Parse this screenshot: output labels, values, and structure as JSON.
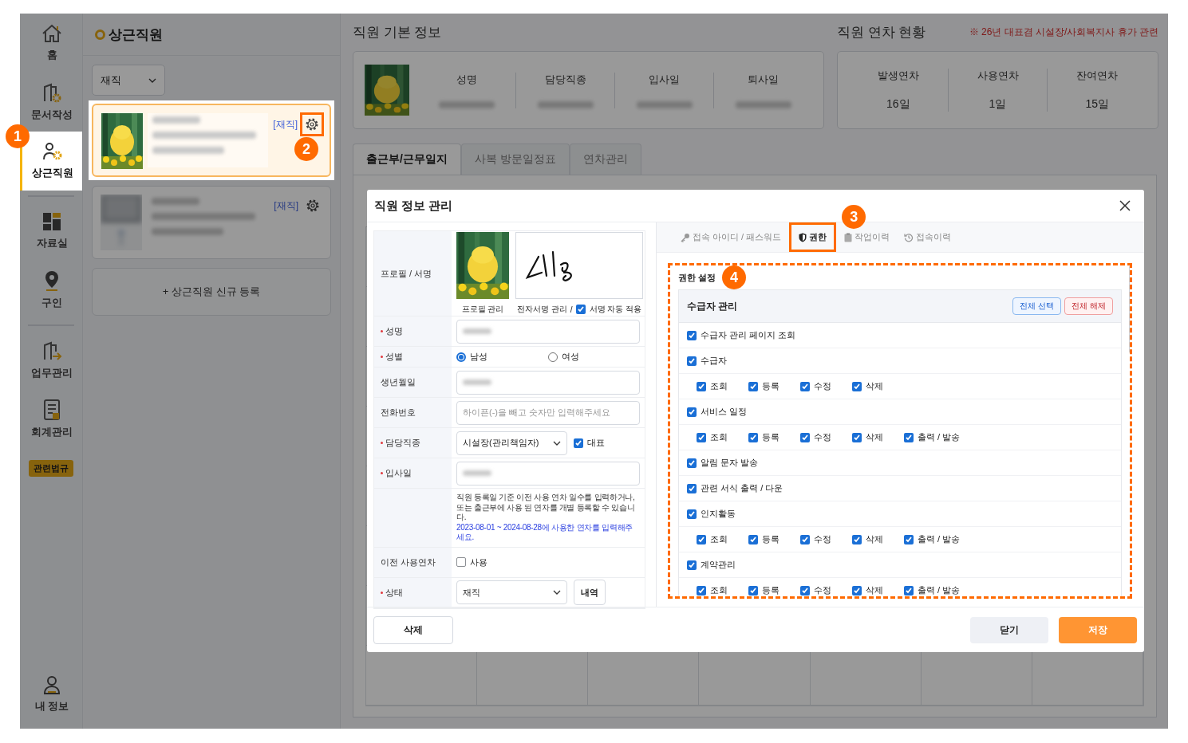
{
  "sidebar": {
    "groups": [
      [
        {
          "label": "홈",
          "selected": false,
          "spotlight": false
        },
        {
          "label": "문서작성",
          "selected": false,
          "spotlight": false
        },
        {
          "label": "상근직원",
          "selected": true,
          "spotlight": true,
          "callout": "1"
        }
      ],
      [
        {
          "label": "자료실",
          "selected": false,
          "spotlight": false
        },
        {
          "label": "구인",
          "selected": false,
          "spotlight": false
        }
      ],
      [
        {
          "label": "업무관리",
          "selected": false,
          "spotlight": false
        },
        {
          "label": "회계관리",
          "selected": false,
          "spotlight": false
        }
      ]
    ],
    "badge": "관련법규",
    "bottom": {
      "label": "내 정보"
    }
  },
  "staff_panel": {
    "title": "상근직원",
    "filter": "재직",
    "cards": [
      {
        "status": "[재직]",
        "selected": true,
        "spotlight": true,
        "gear_callout": "2"
      },
      {
        "status": "[재직]",
        "selected": false,
        "spotlight": false
      }
    ],
    "add_button": "+ 상근직원 신규 등록"
  },
  "basic_info": {
    "title": "직원 기본 정보",
    "columns": [
      "성명",
      "담당직종",
      "입사일",
      "퇴사일"
    ]
  },
  "leave": {
    "title": "직원 연차 현황",
    "notice": "※ 26년 대표겸 시설장/사회복지사 휴가 관련",
    "columns": [
      {
        "label": "발생연차",
        "value": "16일"
      },
      {
        "label": "사용연차",
        "value": "1일"
      },
      {
        "label": "잔여연차",
        "value": "15일"
      }
    ]
  },
  "tabs": [
    {
      "label": "출근부/근무일지",
      "selected": true
    },
    {
      "label": "사복 방문일정표",
      "selected": false
    },
    {
      "label": "연차관리",
      "selected": false
    }
  ],
  "modal": {
    "title": "직원 정보 관리",
    "form": [
      {
        "kind": "profile",
        "label": "프로필 / 서명",
        "required": false,
        "profile_caption": "프로필 관리",
        "signature_caption": "전자서명 관리",
        "separator": "/",
        "auto_sign": {
          "label": "서명 자동 적용",
          "checked": true
        }
      },
      {
        "kind": "text",
        "label": "성명",
        "required": true
      },
      {
        "kind": "radio",
        "label": "성별",
        "required": true,
        "options": [
          {
            "label": "남성",
            "selected": true
          },
          {
            "label": "여성",
            "selected": false
          }
        ]
      },
      {
        "kind": "text",
        "label": "생년월일",
        "required": false
      },
      {
        "kind": "text",
        "label": "전화번호",
        "required": false,
        "placeholder": "하이픈(-)을 빼고 숫자만 입력해주세요"
      },
      {
        "kind": "select",
        "label": "담당직종",
        "required": true,
        "value": "시설장(관리책임자)",
        "checkbox": {
          "label": "대표",
          "checked": true
        }
      },
      {
        "kind": "text",
        "label": "입사일",
        "required": true
      },
      {
        "kind": "note",
        "text": "직원 등록일 기준 이전 사용 연차 일수를 입력하거나, 또는 출근부에 사용 된 연차를 개별 등록할 수 있습니다.",
        "highlight": "2023-08-01 ~ 2024-08-28에 사용한 연차를 입력해주세요."
      },
      {
        "kind": "check",
        "label": "이전 사용연차",
        "required": false,
        "checkbox": {
          "label": "사용",
          "checked": false
        }
      },
      {
        "kind": "select",
        "label": "상태",
        "required": true,
        "value": "재직",
        "button": "내역"
      }
    ],
    "tabs": [
      {
        "label": "접속 아이디 / 패스워드",
        "selected": false
      },
      {
        "label": "권한",
        "selected": true,
        "callout": "3"
      },
      {
        "label": "작업이력",
        "selected": false
      },
      {
        "label": "접속이력",
        "selected": false
      }
    ],
    "permissions": {
      "title": "권한 설정",
      "callout": "4",
      "group": {
        "title": "수급자 관리",
        "select_all": "전체 선택",
        "deselect_all": "전체 해제",
        "rows": [
          {
            "kind": "main",
            "label": "수급자 관리 페이지 조회",
            "checked": true
          },
          {
            "kind": "main",
            "label": "수급자",
            "checked": true
          },
          {
            "kind": "sub",
            "options": [
              {
                "label": "조회",
                "checked": true
              },
              {
                "label": "등록",
                "checked": true
              },
              {
                "label": "수정",
                "checked": true
              },
              {
                "label": "삭제",
                "checked": true
              }
            ]
          },
          {
            "kind": "main",
            "label": "서비스 일정",
            "checked": true
          },
          {
            "kind": "sub",
            "options": [
              {
                "label": "조회",
                "checked": true
              },
              {
                "label": "등록",
                "checked": true
              },
              {
                "label": "수정",
                "checked": true
              },
              {
                "label": "삭제",
                "checked": true
              },
              {
                "label": "출력 / 발송",
                "checked": true
              }
            ]
          },
          {
            "kind": "main",
            "label": "알림 문자 발송",
            "checked": true
          },
          {
            "kind": "main",
            "label": "관련 서식 출력 / 다운",
            "checked": true
          },
          {
            "kind": "main",
            "label": "인지활동",
            "checked": true
          },
          {
            "kind": "sub",
            "options": [
              {
                "label": "조회",
                "checked": true
              },
              {
                "label": "등록",
                "checked": true
              },
              {
                "label": "수정",
                "checked": true
              },
              {
                "label": "삭제",
                "checked": true
              },
              {
                "label": "출력 / 발송",
                "checked": true
              }
            ]
          },
          {
            "kind": "main",
            "label": "계약관리",
            "checked": true
          },
          {
            "kind": "sub",
            "options": [
              {
                "label": "조회",
                "checked": true
              },
              {
                "label": "등록",
                "checked": true
              },
              {
                "label": "수정",
                "checked": true
              },
              {
                "label": "삭제",
                "checked": true
              },
              {
                "label": "출력 / 발송",
                "checked": true
              }
            ]
          }
        ]
      }
    },
    "footer": {
      "delete": "삭제",
      "close": "닫기",
      "save": "저장"
    }
  }
}
